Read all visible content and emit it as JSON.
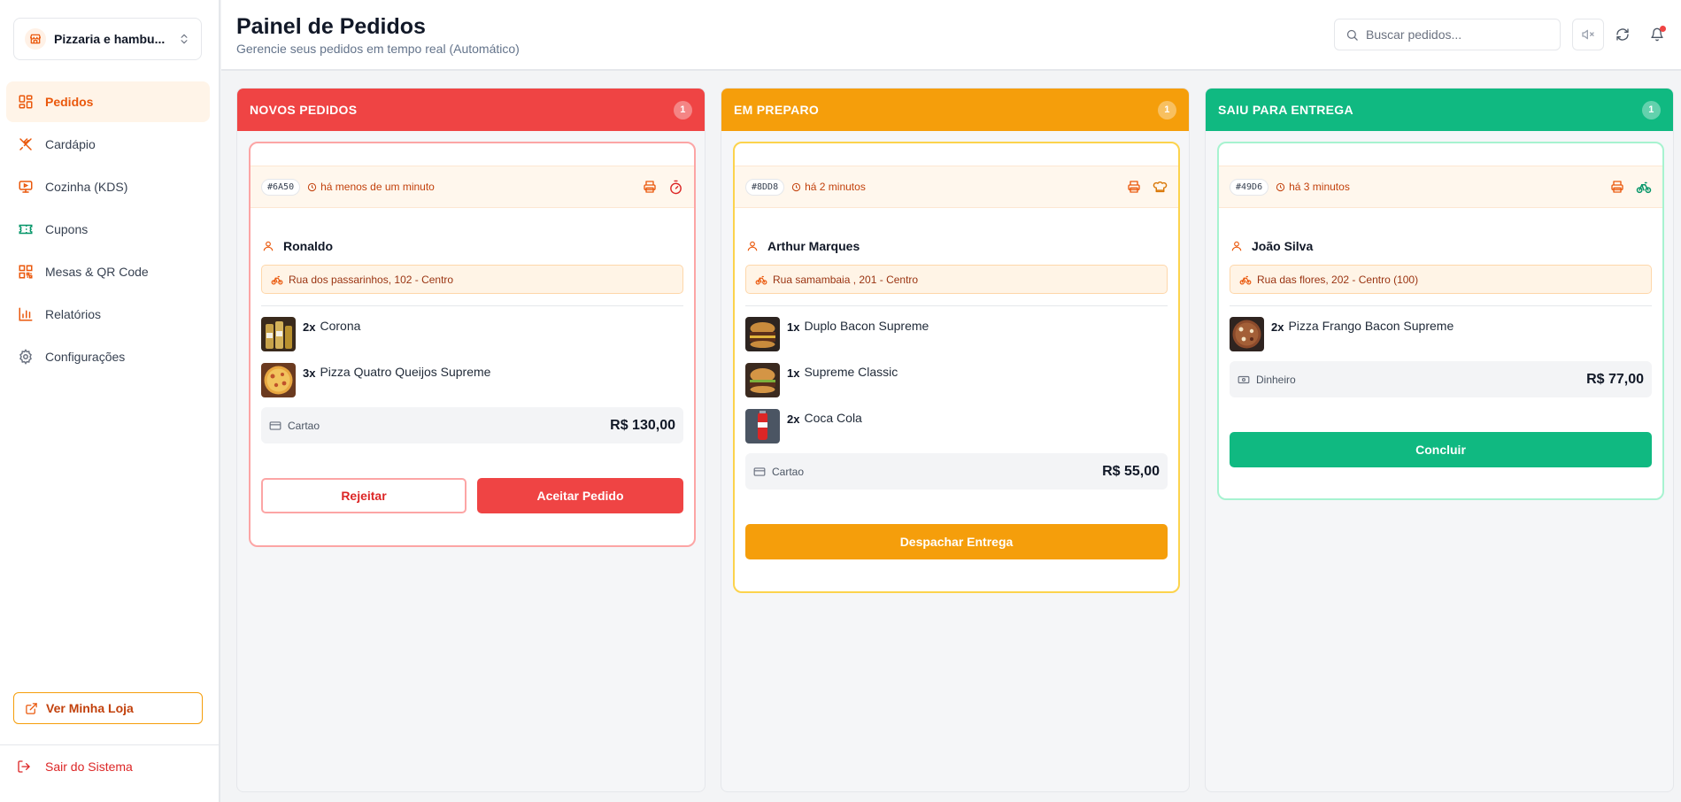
{
  "sidebar": {
    "store_name": "Pizzaria e hambu...",
    "items": [
      {
        "label": "Pedidos",
        "icon": "grid-icon",
        "active": true
      },
      {
        "label": "Cardápio",
        "icon": "utensils-icon"
      },
      {
        "label": "Cozinha (KDS)",
        "icon": "monitor-icon"
      },
      {
        "label": "Cupons",
        "icon": "ticket-icon"
      },
      {
        "label": "Mesas & QR Code",
        "icon": "qr-code-icon"
      },
      {
        "label": "Relatórios",
        "icon": "bar-chart-icon"
      },
      {
        "label": "Configurações",
        "icon": "gear-icon"
      }
    ],
    "store_link": "Ver Minha Loja",
    "logout": "Sair do Sistema"
  },
  "header": {
    "title": "Painel de Pedidos",
    "subtitle": "Gerencie seus pedidos em tempo real (Automático)",
    "search_placeholder": "Buscar pedidos..."
  },
  "colors": {
    "new": "#ef4444",
    "preparing": "#f59e0b",
    "delivering": "#10b981",
    "accent": "#ea580c"
  },
  "columns": [
    {
      "title": "NOVOS PEDIDOS",
      "count": "1",
      "order": {
        "id": "#6A50",
        "time": "há menos de um minuto",
        "customer": "Ronaldo",
        "address": "Rua dos passarinhos, 102 - Centro",
        "items": [
          {
            "qty": "2x",
            "name": "Corona"
          },
          {
            "qty": "3x",
            "name": "Pizza Quatro Queijos Supreme"
          }
        ],
        "payment": "Cartao",
        "total": "R$ 130,00",
        "reject": "Rejeitar",
        "accept": "Aceitar Pedido"
      }
    },
    {
      "title": "EM PREPARO",
      "count": "1",
      "order": {
        "id": "#8DD8",
        "time": "há 2 minutos",
        "customer": "Arthur Marques",
        "address": "Rua samambaia , 201 - Centro",
        "items": [
          {
            "qty": "1x",
            "name": "Duplo Bacon Supreme"
          },
          {
            "qty": "1x",
            "name": "Supreme Classic"
          },
          {
            "qty": "2x",
            "name": "Coca Cola"
          }
        ],
        "payment": "Cartao",
        "total": "R$ 55,00",
        "action": "Despachar Entrega"
      }
    },
    {
      "title": "SAIU PARA ENTREGA",
      "count": "1",
      "order": {
        "id": "#49D6",
        "time": "há 3 minutos",
        "customer": "João Silva",
        "address": "Rua das flores, 202 - Centro (100)",
        "items": [
          {
            "qty": "2x",
            "name": "Pizza Frango Bacon Supreme"
          }
        ],
        "payment": "Dinheiro",
        "total": "R$ 77,00",
        "action": "Concluir"
      }
    }
  ]
}
